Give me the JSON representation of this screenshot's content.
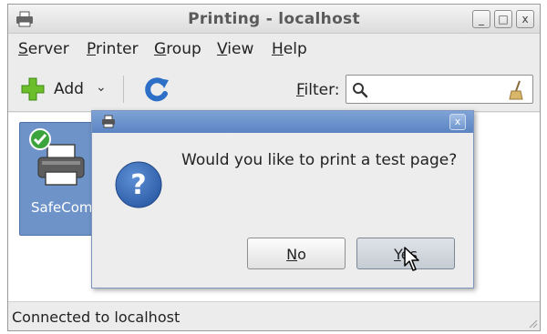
{
  "window": {
    "title": "Printing - localhost",
    "controls": {
      "minimize": "_",
      "maximize": "□",
      "close": "x"
    }
  },
  "menubar": {
    "items": [
      {
        "mnemonic": "S",
        "rest": "erver"
      },
      {
        "mnemonic": "P",
        "rest": "rinter"
      },
      {
        "mnemonic": "G",
        "rest": "roup"
      },
      {
        "mnemonic": "V",
        "rest": "iew"
      },
      {
        "mnemonic": "H",
        "rest": "elp"
      }
    ]
  },
  "toolbar": {
    "add_label": "Add",
    "add_chevron": "⌄",
    "filter_mnemonic": "F",
    "filter_rest": "ilter:",
    "filter_value": ""
  },
  "printers": [
    {
      "name": "SafeCom"
    }
  ],
  "statusbar": {
    "text": "Connected to localhost"
  },
  "dialog": {
    "close_glyph": "x",
    "message": "Would you like to print a test page?",
    "no_mnemonic": "N",
    "no_rest": "o",
    "yes_mnemonic": "Y",
    "yes_rest": "es"
  },
  "colors": {
    "selection": "#6e93c8",
    "dialog_title": "#5b84c2",
    "question_icon": "#2f5fa8",
    "add_icon": "#6cbf2a",
    "refresh_icon": "#2d6fc7",
    "check_badge": "#3ca43c"
  }
}
